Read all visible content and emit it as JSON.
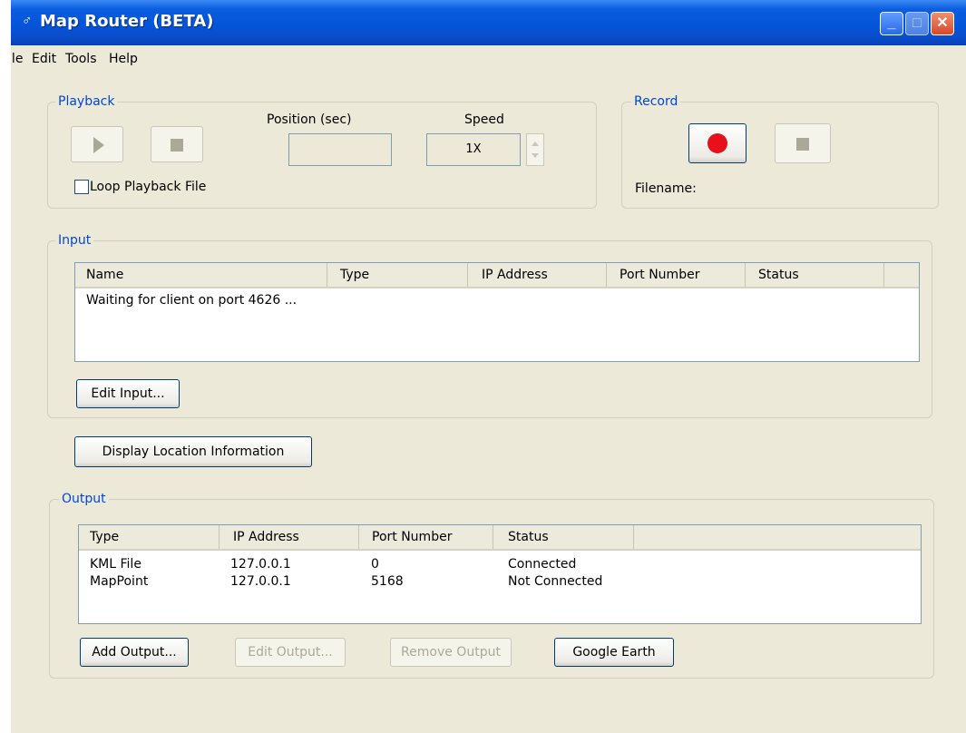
{
  "window": {
    "title": "Map Router (BETA)",
    "min_label": "_",
    "max_label": "□",
    "close_label": "✕"
  },
  "menu": [
    "File",
    "Edit",
    "Tools",
    "Help"
  ],
  "playback": {
    "group_label": "Playback",
    "position_label": "Position (sec)",
    "position_value": "",
    "speed_label": "Speed",
    "speed_value": "1X",
    "loop_label": "Loop Playback File",
    "loop_checked": false
  },
  "record": {
    "group_label": "Record",
    "filename_label": "Filename:"
  },
  "input": {
    "group_label": "Input",
    "columns": [
      "Name",
      "Type",
      "IP Address",
      "Port Number",
      "Status"
    ],
    "rows": [
      [
        "Waiting for client on port 4626 ...",
        "",
        "",
        "",
        ""
      ]
    ],
    "edit_button": "Edit Input..."
  },
  "display_location_button": "Display Location Information",
  "output": {
    "group_label": "Output",
    "columns": [
      "Type",
      "IP Address",
      "Port Number",
      "Status"
    ],
    "rows": [
      [
        "KML File",
        "127.0.0.1",
        "0",
        "Connected"
      ],
      [
        "MapPoint",
        "127.0.0.1",
        "5168",
        "Not Connected"
      ]
    ],
    "add_button": "Add Output...",
    "edit_button": "Edit Output...",
    "remove_button": "Remove Output",
    "google_earth_button": "Google Earth"
  },
  "colors": {
    "record_dot": "#e8101a",
    "group_label": "#0046d5",
    "titlebar": "#0553d8"
  }
}
